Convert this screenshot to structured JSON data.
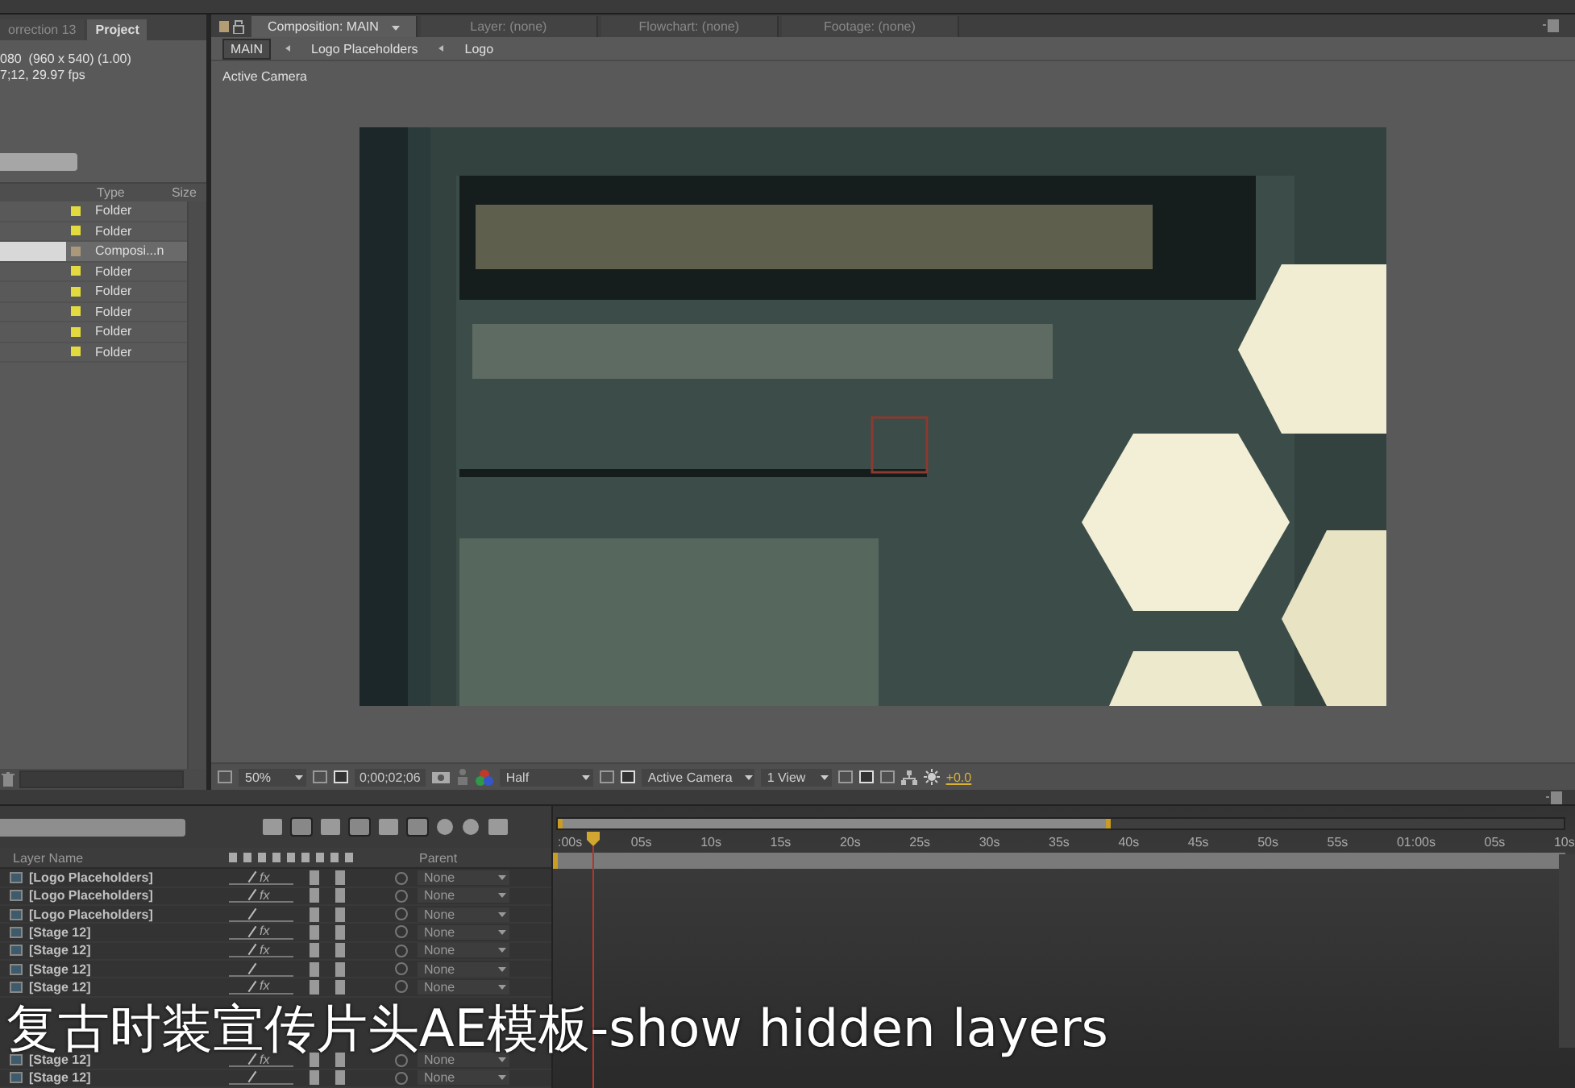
{
  "project_panel": {
    "tabs": [
      {
        "label": "orrection 13",
        "selected": false
      },
      {
        "label": "Project",
        "selected": true
      }
    ],
    "info": [
      "080  (960 x 540) (1.00)",
      "7;12, 29.97 fps"
    ],
    "columns": [
      "Type",
      "Size"
    ],
    "items": [
      {
        "type": "Folder",
        "color": "#e3da3f",
        "selected": false
      },
      {
        "type": "Folder",
        "color": "#e3da3f",
        "selected": false
      },
      {
        "type": "Composi...n",
        "color": "#ab987a",
        "selected": true
      },
      {
        "type": "Folder",
        "color": "#e3da3f",
        "selected": false
      },
      {
        "type": "Folder",
        "color": "#e3da3f",
        "selected": false
      },
      {
        "type": "Folder",
        "color": "#e3da3f",
        "selected": false
      },
      {
        "type": "Folder",
        "color": "#e3da3f",
        "selected": false
      },
      {
        "type": "Folder",
        "color": "#e3da3f",
        "selected": false
      }
    ]
  },
  "composition_panel": {
    "tabs": [
      {
        "label": "Composition: MAIN",
        "selected": true
      },
      {
        "label": "Layer: (none)",
        "selected": false
      },
      {
        "label": "Flowchart: (none)",
        "selected": false
      },
      {
        "label": "Footage: (none)",
        "selected": false
      }
    ],
    "breadcrumbs": [
      {
        "label": "MAIN",
        "selected": true
      },
      {
        "label": "Logo Placeholders",
        "selected": false
      },
      {
        "label": "Logo",
        "selected": false
      }
    ],
    "view_label": "Active Camera",
    "controls": {
      "zoom": "50%",
      "timecode": "0;00;02;06",
      "resolution": "Half",
      "camera": "Active Camera",
      "views": "1 View",
      "exposure": "+0.0"
    }
  },
  "timeline": {
    "ruler": [
      ":00s",
      "05s",
      "10s",
      "15s",
      "20s",
      "25s",
      "30s",
      "35s",
      "40s",
      "45s",
      "50s",
      "55s",
      "01:00s",
      "05s",
      "10s"
    ],
    "columns": [
      "Layer Name",
      "Parent"
    ],
    "layers": [
      {
        "kind": "layer",
        "name": "[Logo Placeholders]",
        "effect_label": "fx",
        "parent": "None"
      },
      {
        "kind": "layer",
        "name": "[Logo Placeholders]",
        "effect_label": "fx",
        "parent": "None"
      },
      {
        "kind": "layer",
        "name": "[Logo Placeholders]",
        "parent": "None"
      },
      {
        "kind": "layer",
        "name": "[Stage 12]",
        "effect_label": "fx",
        "parent": "None"
      },
      {
        "kind": "layer",
        "name": "[Stage 12]",
        "effect_label": "fx",
        "parent": "None"
      },
      {
        "kind": "layer",
        "name": "[Stage 12]",
        "parent": "None"
      },
      {
        "kind": "layer",
        "name": "[Stage 12]",
        "effect_label": "fx",
        "parent": "None"
      },
      {
        "kind": "covered"
      },
      {
        "kind": "covered"
      },
      {
        "kind": "covered"
      },
      {
        "kind": "layer",
        "name": "[Stage 12]",
        "effect_label": "fx",
        "parent": "None"
      },
      {
        "kind": "layer",
        "name": "[Stage 12]",
        "parent": "None"
      }
    ]
  },
  "caption": "复古时装宣传片头AE模板-show hidden layers"
}
